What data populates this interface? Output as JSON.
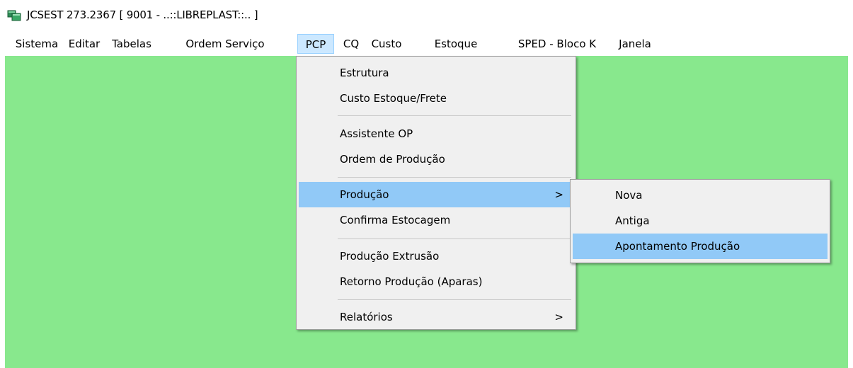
{
  "window": {
    "title": "JCSEST 273.2367 [ 9001 - ..::LIBREPLAST::.. ]",
    "icon": "app-window-icon"
  },
  "menubar": {
    "items": [
      {
        "label": "Sistema"
      },
      {
        "label": "Editar"
      },
      {
        "label": "Tabelas"
      },
      {
        "label": "Ordem Serviço"
      },
      {
        "label": "PCP",
        "active": true
      },
      {
        "label": "CQ"
      },
      {
        "label": "Custo"
      },
      {
        "label": "Estoque"
      },
      {
        "label": "SPED - Bloco K"
      },
      {
        "label": "Janela"
      }
    ]
  },
  "pcp_menu": {
    "items": [
      {
        "label": "Estrutura"
      },
      {
        "label": "Custo Estoque/Frete"
      },
      {
        "label": "Assistente OP"
      },
      {
        "label": "Ordem de Produção"
      },
      {
        "label": "Produção",
        "arrow": ">",
        "highlighted": true
      },
      {
        "label": "Confirma Estocagem"
      },
      {
        "label": "Produção Extrusão"
      },
      {
        "label": "Retorno Produção (Aparas)"
      },
      {
        "label": "Relatórios",
        "arrow": ">"
      }
    ]
  },
  "producao_submenu": {
    "items": [
      {
        "label": "Nova"
      },
      {
        "label": "Antiga"
      },
      {
        "label": "Apontamento Produção",
        "highlighted": true
      }
    ]
  },
  "colors": {
    "workspace": "#88e88d",
    "menu_background": "#f0f0f0",
    "highlight": "#91c9f7",
    "active_menubar": "#cce8ff"
  }
}
